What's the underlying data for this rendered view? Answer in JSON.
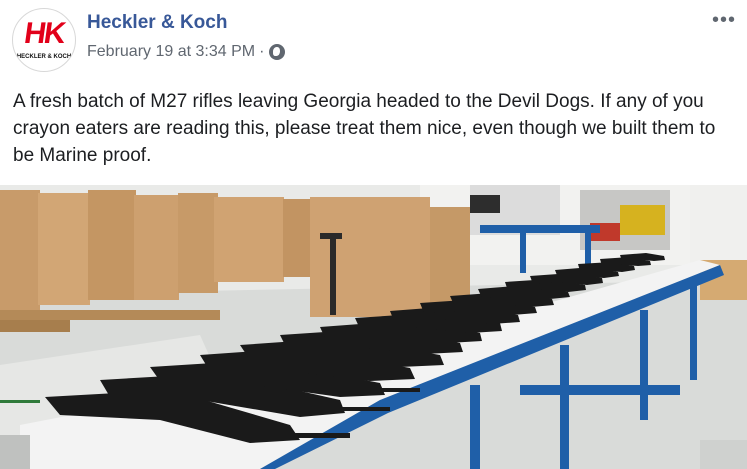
{
  "post": {
    "page_name": "Heckler & Koch",
    "date": "February 19 at 3:34 PM",
    "separator": "·",
    "audience_icon": "globe-icon",
    "more_icon": "more-options-icon",
    "more_label": "•••",
    "text": "A fresh batch of M27 rifles leaving Georgia headed to the Devil Dogs. If any of you crayon eaters are reading this, please treat them nice, even though we built them to be Marine proof."
  },
  "avatar": {
    "logo_text": "HK",
    "logo_subtext": "HECKLER & KOCH",
    "brand_color": "#e2001a"
  },
  "colors": {
    "link": "#385898",
    "meta": "#606770",
    "text": "#1c1e21",
    "table_blue": "#1f5fa8"
  },
  "photo": {
    "description_icon": "rifles-on-workbench-photo"
  }
}
